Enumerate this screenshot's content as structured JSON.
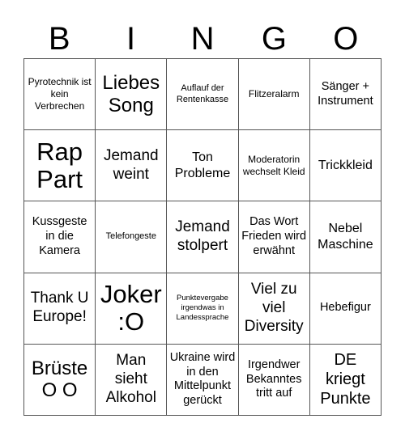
{
  "header": {
    "letters": [
      "B",
      "I",
      "N",
      "G",
      "O"
    ]
  },
  "cells": [
    [
      "Pyrotechnik ist kein Verbrechen",
      "Liebes Song",
      "Auflauf der Rentenkasse",
      "Flitzeralarm",
      "Sänger + Instrument"
    ],
    [
      "Rap Part",
      "Jemand weint",
      "Ton Probleme",
      "Moderatorin wechselt Kleid",
      "Trickkleid"
    ],
    [
      "Kussgeste in die Kamera",
      "Telefongeste",
      "Jemand stolpert",
      "Das Wort Frieden wird erwähnt",
      "Nebel Maschine"
    ],
    [
      "Thank U Europe!",
      "Joker :O",
      "Punktevergabe irgendwas in Landessprache",
      "Viel zu viel Diversity",
      "Hebefigur"
    ],
    [
      "Brüste O O",
      "Man sieht Alkohol",
      "Ukraine wird in den Mittelpunkt gerückt",
      "Irgendwer Bekanntes tritt auf",
      "DE kriegt Punkte"
    ]
  ]
}
